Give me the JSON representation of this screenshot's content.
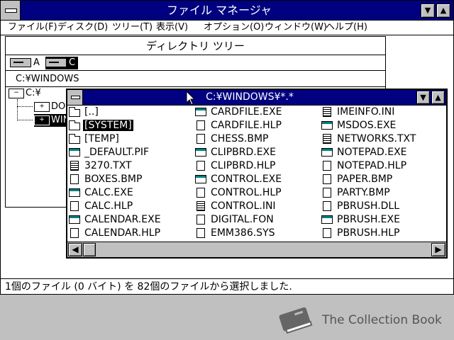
{
  "window": {
    "title": "ファイル マネージャ",
    "min_glyph": "▼",
    "max_glyph": "▲"
  },
  "menu": [
    "ファイル(F)",
    "ディスク(D)",
    "ツリー(T)",
    "表示(V)",
    "オプション(O)",
    "ウィンドウ(W)",
    "ヘルプ(H)"
  ],
  "tree": {
    "title": "ディレクトリ ツリー",
    "drives": [
      {
        "letter": "A",
        "selected": false
      },
      {
        "letter": "C",
        "selected": true
      }
    ],
    "current_path": "C:¥WINDOWS",
    "nodes": [
      {
        "label": "C:¥",
        "icon": "minus"
      },
      {
        "label": "DO",
        "icon": "plus"
      },
      {
        "label": "WIN",
        "icon": "plus",
        "selected": true
      }
    ]
  },
  "files": {
    "title": "C:¥WINDOWS¥*.*",
    "columns": [
      [
        {
          "name": "[..]",
          "icon": "folder"
        },
        {
          "name": "[SYSTEM]",
          "icon": "folder",
          "selected": true
        },
        {
          "name": "[TEMP]",
          "icon": "folder"
        },
        {
          "name": "_DEFAULT.PIF",
          "icon": "exe"
        },
        {
          "name": "3270.TXT",
          "icon": "txt"
        },
        {
          "name": "BOXES.BMP",
          "icon": "doc"
        },
        {
          "name": "CALC.EXE",
          "icon": "exe"
        },
        {
          "name": "CALC.HLP",
          "icon": "doc"
        },
        {
          "name": "CALENDAR.EXE",
          "icon": "exe"
        },
        {
          "name": "CALENDAR.HLP",
          "icon": "doc"
        }
      ],
      [
        {
          "name": "CARDFILE.EXE",
          "icon": "exe"
        },
        {
          "name": "CARDFILE.HLP",
          "icon": "doc"
        },
        {
          "name": "CHESS.BMP",
          "icon": "doc"
        },
        {
          "name": "CLIPBRD.EXE",
          "icon": "exe"
        },
        {
          "name": "CLIPBRD.HLP",
          "icon": "doc"
        },
        {
          "name": "CONTROL.EXE",
          "icon": "exe"
        },
        {
          "name": "CONTROL.HLP",
          "icon": "doc"
        },
        {
          "name": "CONTROL.INI",
          "icon": "txt"
        },
        {
          "name": "DIGITAL.FON",
          "icon": "doc"
        },
        {
          "name": "EMM386.SYS",
          "icon": "doc"
        }
      ],
      [
        {
          "name": "IMEINFO.INI",
          "icon": "txt"
        },
        {
          "name": "MSDOS.EXE",
          "icon": "exe"
        },
        {
          "name": "NETWORKS.TXT",
          "icon": "txt"
        },
        {
          "name": "NOTEPAD.EXE",
          "icon": "exe"
        },
        {
          "name": "NOTEPAD.HLP",
          "icon": "doc"
        },
        {
          "name": "PAPER.BMP",
          "icon": "doc"
        },
        {
          "name": "PARTY.BMP",
          "icon": "doc"
        },
        {
          "name": "PBRUSH.DLL",
          "icon": "doc"
        },
        {
          "name": "PBRUSH.EXE",
          "icon": "exe"
        },
        {
          "name": "PBRUSH.HLP",
          "icon": "doc"
        }
      ]
    ],
    "scroll_left_glyph": "◀",
    "scroll_right_glyph": "▶"
  },
  "status": "1個のファイル (0 バイト) を 82個のファイルから選択しました.",
  "watermark": "The Collection Book",
  "colors": {
    "title_bar": "#000080",
    "desktop": "#c0c0c0",
    "icon_accent": "#008080"
  }
}
